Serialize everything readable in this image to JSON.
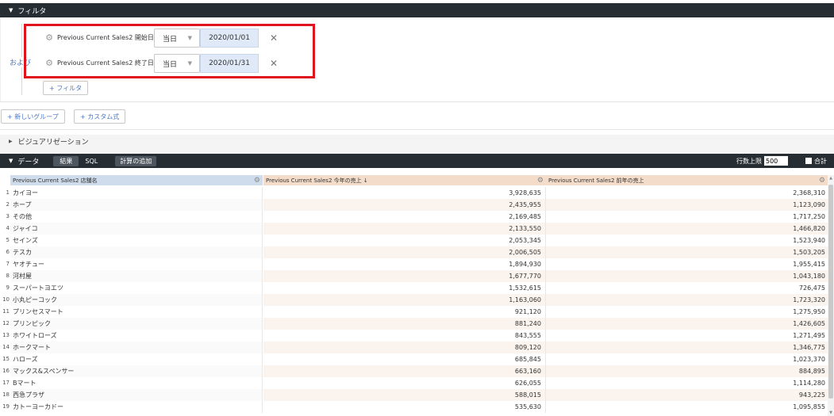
{
  "filter_section": {
    "title": "フィルタ",
    "conjunction": "および",
    "filters": [
      {
        "label": "Previous Current Sales2 開始日",
        "mode": "当日",
        "date": "2020/01/01"
      },
      {
        "label": "Previous Current Sales2 終了日",
        "mode": "当日",
        "date": "2020/01/31"
      }
    ],
    "add_filter": "+ フィルタ",
    "new_group": "+ 新しいグループ",
    "custom_expr": "+ カスタム式"
  },
  "visualization": {
    "title": "ビジュアリゼーション"
  },
  "data_section": {
    "title": "データ",
    "tabs": [
      "結果",
      "SQL"
    ],
    "add_calc": "計算の追加",
    "row_limit_label": "行数上限",
    "row_limit_value": "500",
    "total_label": "合計"
  },
  "table": {
    "columns": [
      "Previous Current Sales2 店舗名",
      "Previous Current Sales2 今年の売上 ↓",
      "Previous Current Sales2 前年の売上"
    ],
    "rows": [
      {
        "idx": "1",
        "name": "カイヨー",
        "cur": "3,928,635",
        "prev": "2,368,310"
      },
      {
        "idx": "2",
        "name": "ホープ",
        "cur": "2,435,955",
        "prev": "1,123,090"
      },
      {
        "idx": "3",
        "name": "その他",
        "cur": "2,169,485",
        "prev": "1,717,250"
      },
      {
        "idx": "4",
        "name": "ジャイコ",
        "cur": "2,133,550",
        "prev": "1,466,820"
      },
      {
        "idx": "5",
        "name": "セインズ",
        "cur": "2,053,345",
        "prev": "1,523,940"
      },
      {
        "idx": "6",
        "name": "テスカ",
        "cur": "2,006,505",
        "prev": "1,503,205"
      },
      {
        "idx": "7",
        "name": "ヤオチュー",
        "cur": "1,894,930",
        "prev": "1,955,415"
      },
      {
        "idx": "8",
        "name": "河村屋",
        "cur": "1,677,770",
        "prev": "1,043,180"
      },
      {
        "idx": "9",
        "name": "スーパートヨエツ",
        "cur": "1,532,615",
        "prev": "726,475"
      },
      {
        "idx": "10",
        "name": "小丸ピーコック",
        "cur": "1,163,060",
        "prev": "1,723,320"
      },
      {
        "idx": "11",
        "name": "プリンセスマート",
        "cur": "921,120",
        "prev": "1,275,950"
      },
      {
        "idx": "12",
        "name": "プリンピック",
        "cur": "881,240",
        "prev": "1,426,605"
      },
      {
        "idx": "13",
        "name": "ホワイトローズ",
        "cur": "843,555",
        "prev": "1,271,495"
      },
      {
        "idx": "14",
        "name": "ホークマート",
        "cur": "809,120",
        "prev": "1,346,775"
      },
      {
        "idx": "15",
        "name": "ハローズ",
        "cur": "685,845",
        "prev": "1,023,370"
      },
      {
        "idx": "16",
        "name": "マックス&スペンサー",
        "cur": "663,160",
        "prev": "884,895"
      },
      {
        "idx": "17",
        "name": "Bマート",
        "cur": "626,055",
        "prev": "1,114,280"
      },
      {
        "idx": "18",
        "name": "西急プラザ",
        "cur": "588,015",
        "prev": "943,225"
      },
      {
        "idx": "19",
        "name": "カトーヨーカドー",
        "cur": "535,630",
        "prev": "1,095,855"
      }
    ]
  },
  "colors": {
    "header_dark": "#262d33",
    "highlight_box": "#e0141e",
    "dimension_header": "#cfdcec",
    "measure_header": "#f3dcca",
    "link_blue": "#4a77c4"
  }
}
